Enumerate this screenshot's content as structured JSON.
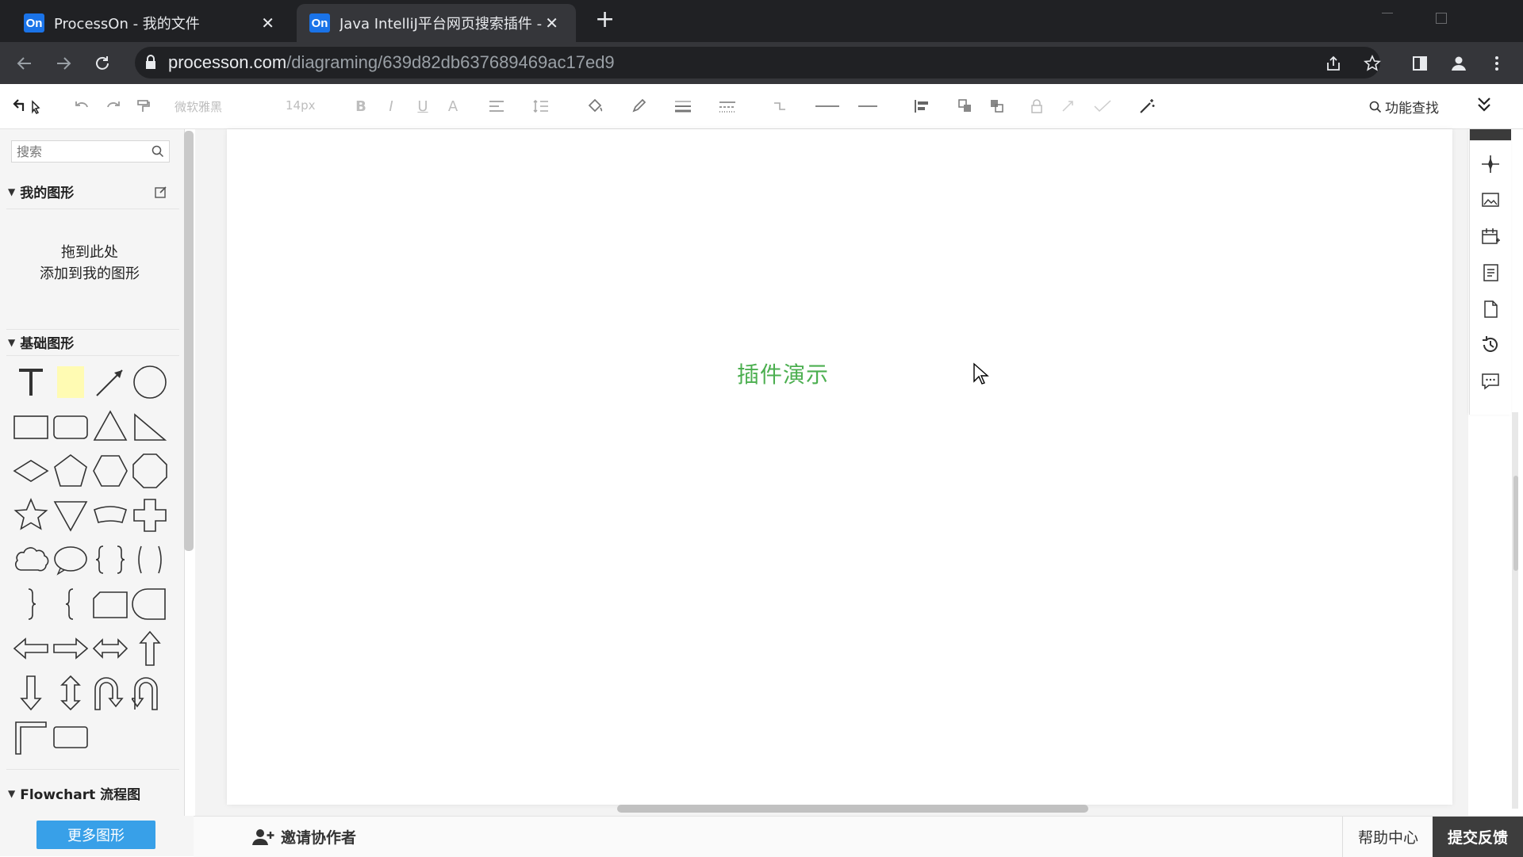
{
  "browser": {
    "tabs": [
      {
        "favicon": "On",
        "title": "ProcessOn - 我的文件"
      },
      {
        "favicon": "On",
        "title": "Java IntelliJ平台网页搜索插件 -"
      }
    ],
    "url_host": "processon.com",
    "url_path": "/diagraming/639d82db637689469ac17ed9"
  },
  "toolbar": {
    "font_family": "微软雅黑",
    "font_size": "14px",
    "find_label": "功能查找"
  },
  "left_panel": {
    "search_placeholder": "搜索",
    "my_shapes": {
      "title": "我的图形",
      "drop_line1": "拖到此处",
      "drop_line2": "添加到我的图形"
    },
    "basic_shapes_title": "基础图形",
    "flowchart_title": "Flowchart 流程图",
    "more_shapes": "更多图形"
  },
  "canvas": {
    "text": "插件演示",
    "text_color": "#4caf50"
  },
  "bottom": {
    "invite": "邀请协作者",
    "help": "帮助中心",
    "feedback": "提交反馈"
  },
  "colors": {
    "accent": "#38a0e8",
    "feedback_bg": "#3d3d3d",
    "note_fill": "#fffbb3"
  }
}
